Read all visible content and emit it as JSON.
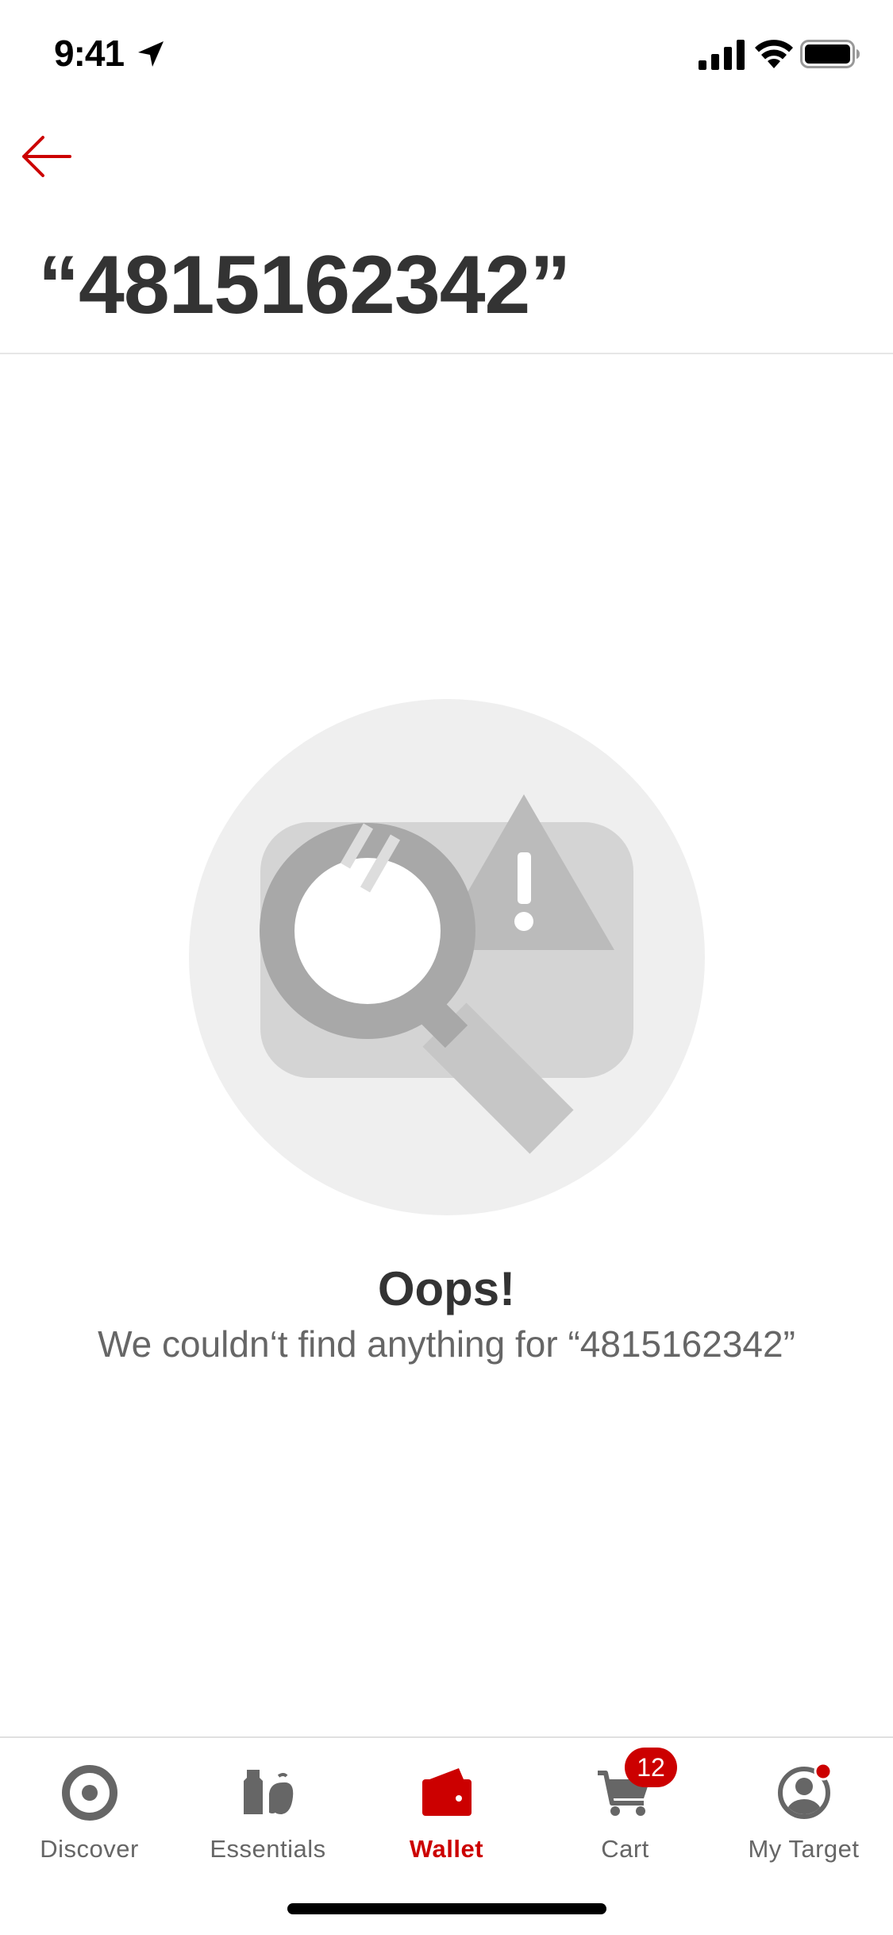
{
  "status_bar": {
    "time": "9:41"
  },
  "header": {
    "back_icon": "arrow-left-icon",
    "title": "“4815162342”"
  },
  "empty_state": {
    "illustration": "magnifier-warning-card",
    "title": "Oops!",
    "message": "We couldn‘t find anything for “4815162342”"
  },
  "tab_bar": {
    "items": [
      {
        "label": "Discover",
        "icon": "target-icon"
      },
      {
        "label": "Essentials",
        "icon": "essentials-icon"
      },
      {
        "label": "Wallet",
        "icon": "wallet-icon",
        "active": true
      },
      {
        "label": "Cart",
        "icon": "cart-icon",
        "badge": "12"
      },
      {
        "label": "My Target",
        "icon": "profile-icon"
      }
    ]
  },
  "colors": {
    "accent": "#cc0000",
    "title_text": "#333333",
    "secondary_text": "#666666"
  }
}
